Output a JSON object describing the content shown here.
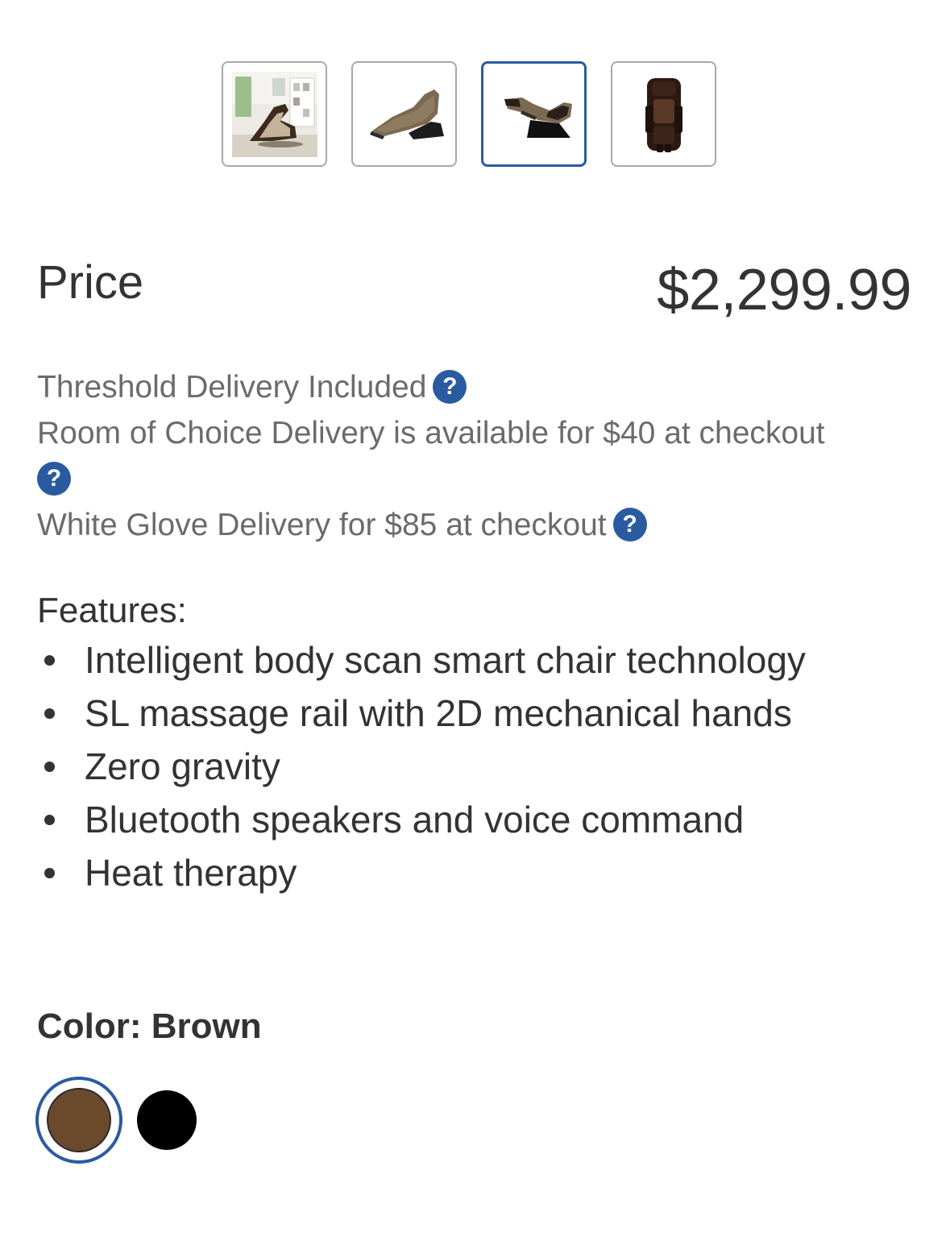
{
  "gallery": {
    "thumbnails": [
      {
        "name": "lifestyle-room-image",
        "selected": false
      },
      {
        "name": "side-recline-image",
        "selected": false
      },
      {
        "name": "zero-gravity-image",
        "selected": true
      },
      {
        "name": "front-view-image",
        "selected": false
      }
    ]
  },
  "price": {
    "label": "Price",
    "value": "$2,299.99"
  },
  "delivery": {
    "threshold": "Threshold Delivery Included",
    "room_of_choice": "Room of Choice Delivery is available for $40 at checkout",
    "white_glove": "White Glove Delivery for $85 at checkout",
    "help_icon_glyph": "?"
  },
  "features": {
    "title": "Features:",
    "items": [
      "Intelligent body scan smart chair technology",
      "SL massage rail with 2D mechanical hands",
      "Zero gravity",
      "Bluetooth speakers and voice command",
      "Heat therapy"
    ]
  },
  "color": {
    "label": "Color: Brown",
    "options": [
      {
        "name": "Brown",
        "hex": "#6b4a2c",
        "selected": true
      },
      {
        "name": "Black",
        "hex": "#000000",
        "selected": false
      }
    ]
  },
  "colors": {
    "accent": "#2a5ba0",
    "text": "#333333",
    "muted_text": "#6b6b6b"
  }
}
